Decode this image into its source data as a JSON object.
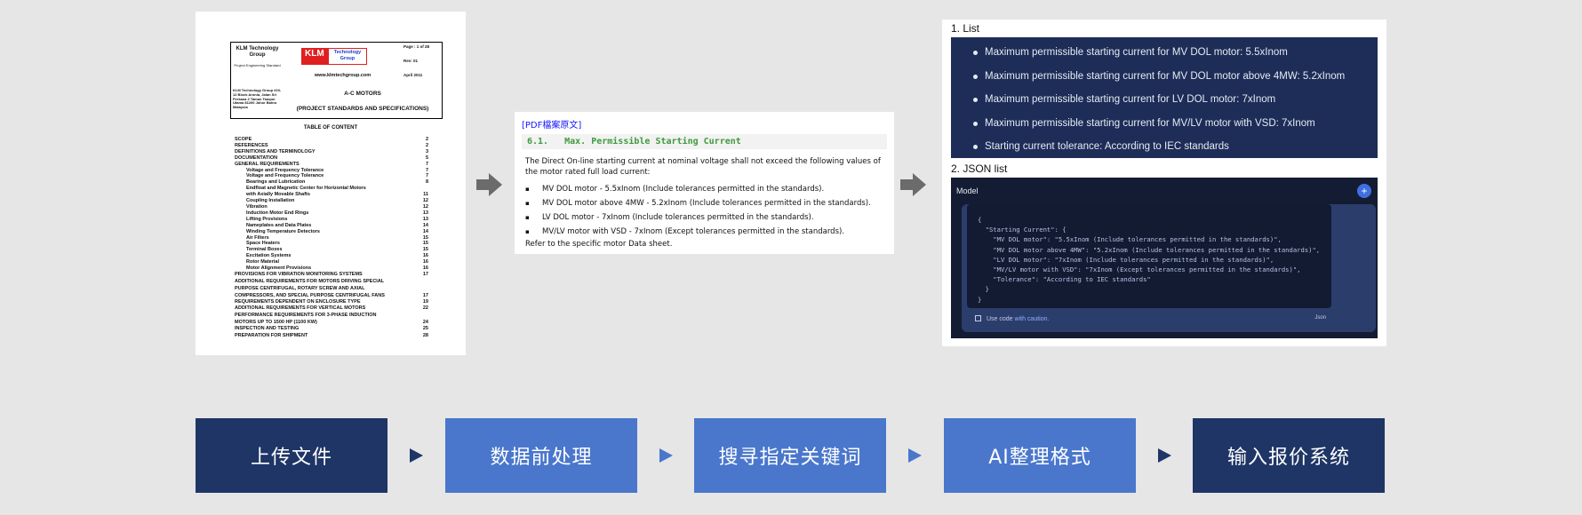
{
  "document": {
    "company": "KLM Technology Group",
    "company_sub": "Project Engineering Standard",
    "logo_left": "KLM",
    "logo_right_1": "Technology",
    "logo_right_2": "Group",
    "website": "www.klmtechgroup.com",
    "page": "Page : 1 of 28",
    "rev": "Rev: 01",
    "date": "April 2011",
    "address": "KLM Technology Group #03-12 Block Aronia, Jalan Sri Perkasa 2 Taman Tampoi Utama 81200 Johor Bahru Malaysia",
    "title": "A-C MOTORS",
    "subtitle": "(PROJECT STANDARDS AND SPECIFICATIONS)",
    "toc_heading": "TABLE OF CONTENT",
    "toc": [
      {
        "t": "SCOPE",
        "p": "2",
        "i": false
      },
      {
        "t": "REFERENCES",
        "p": "2",
        "i": false
      },
      {
        "t": "DEFINITIONS AND TERMINOLOGY",
        "p": "3",
        "i": false
      },
      {
        "t": "DOCUMENTATION",
        "p": "5",
        "i": false
      },
      {
        "t": "GENERAL REQUIREMENTS",
        "p": "7",
        "i": false
      },
      {
        "t": "Voltage and Frequency Tolerance",
        "p": "7",
        "i": true
      },
      {
        "t": "Voltage and Frequency Tolerance",
        "p": "7",
        "i": true
      },
      {
        "t": "Bearings and Lubrication",
        "p": "8",
        "i": true
      },
      {
        "t": "Endfloat and Magnetic Center for Horizontal Motors",
        "p": "",
        "i": true
      },
      {
        "t": "with Axially Movable Shafts",
        "p": "11",
        "i": true
      },
      {
        "t": "Coupling Installation",
        "p": "12",
        "i": true
      },
      {
        "t": "Vibration",
        "p": "12",
        "i": true
      },
      {
        "t": "Induction Motor End Rings",
        "p": "13",
        "i": true
      },
      {
        "t": "Lifting Provisions",
        "p": "13",
        "i": true
      },
      {
        "t": "Nameplates and Data Plates",
        "p": "14",
        "i": true
      },
      {
        "t": "Winding Temperature Detectors",
        "p": "14",
        "i": true
      },
      {
        "t": "Air Filters",
        "p": "15",
        "i": true
      },
      {
        "t": "Space Heaters",
        "p": "15",
        "i": true
      },
      {
        "t": "Terminal Boxes",
        "p": "15",
        "i": true
      },
      {
        "t": "Excitation Systems",
        "p": "16",
        "i": true
      },
      {
        "t": "Rotor Material",
        "p": "16",
        "i": true
      },
      {
        "t": "Motor Alignment Provisions",
        "p": "16",
        "i": true
      },
      {
        "t": "PROVISIONS FOR VIBRATION MONITORING SYSTEMS",
        "p": "17",
        "i": false
      },
      {
        "t": "ADDITIONAL REQUIREMENTS FOR MOTORS DRIVING SPECIAL",
        "p": "",
        "i": false,
        "g": true
      },
      {
        "t": "PURPOSE CENTRIFUGAL, ROTARY SCREW AND AXIAL",
        "p": "",
        "i": false,
        "g": true
      },
      {
        "t": "COMPRESSORS, AND SPECIAL PURPOSE CENTRIFUGAL FANS",
        "p": "17",
        "i": false,
        "g": true
      },
      {
        "t": "REQUIREMENTS DEPENDENT ON ENCLOSURE TYPE",
        "p": "19",
        "i": false
      },
      {
        "t": "ADDITIONAL REQUIREMENTS FOR VERTICAL MOTORS",
        "p": "22",
        "i": false,
        "g": true
      },
      {
        "t": "PERFORMANCE REQUIREMENTS FOR 3-PHASE INDUCTION",
        "p": "",
        "i": false,
        "g": true
      },
      {
        "t": "MOTORS UP TO 1500 HP (1100 KW)",
        "p": "24",
        "i": false,
        "g": true
      },
      {
        "t": "INSPECTION AND TESTING",
        "p": "25",
        "i": false
      },
      {
        "t": "PREPARATION FOR SHIPMENT",
        "p": "28",
        "i": false,
        "g": true
      }
    ]
  },
  "pdf": {
    "source_label": "[PDF檔案原文]",
    "section_no": "6.1.",
    "section_title": "Max. Permissible Starting Current",
    "intro": "The Direct On-line starting current at nominal voltage shall not exceed the following values of the motor rated full load current:",
    "bullet": "▪",
    "items": [
      "MV DOL motor - 5.5xInom (Include tolerances permitted in the standards).",
      "MV DOL motor above 4MW - 5.2xInom (Include tolerances permitted in the standards).",
      "LV DOL motor - 7xInom (Include tolerances permitted in the standards).",
      "MV/LV motor with VSD - 7xInom (Except tolerances permitted in the standards)."
    ],
    "footer": "Refer to the specific motor Data sheet."
  },
  "list_section": {
    "label": "1. List",
    "items": [
      "Maximum permissible starting current for MV DOL motor: 5.5xInom",
      "Maximum permissible starting current for MV DOL motor above 4MW: 5.2xInom",
      "Maximum permissible starting current for LV DOL motor: 7xInom",
      "Maximum permissible starting current for MV/LV motor with VSD: 7xInom",
      "Starting current tolerance: According to IEC standards"
    ]
  },
  "json_section": {
    "label": "2. JSON list",
    "model_label": "Model",
    "plus": "+",
    "code_lines": [
      "{",
      "  \"Starting Current\": {",
      "    \"MV DOL motor\": \"5.5xInom (Include tolerances permitted in the standards)\",",
      "    \"MV DOL motor above 4MW\": \"5.2xInom (Include tolerances permitted in the standards)\",",
      "    \"LV DOL motor\": \"7xInom (Include tolerances permitted in the standards)\",",
      "    \"MV/LV motor with VSD\": \"7xInom (Except tolerances permitted in the standards)\",",
      "    \"Tolerance\": \"According to IEC standards\"",
      "  }",
      "}"
    ],
    "footer_text": "Use code ",
    "footer_link": "with caution.",
    "footer_lang": "Json"
  },
  "flow": {
    "steps": [
      "上传文件",
      "数据前处理",
      "搜寻指定关键词",
      "AI整理格式",
      "输入报价系统"
    ]
  },
  "colors": {
    "background": "#e6e6e6",
    "step_dark": "#1f3566",
    "step_light": "#4a77cc",
    "list_bg": "#1d2d57",
    "json_bg": "#141c33",
    "section_green": "#3d9a3d",
    "link_blue": "#1515ff",
    "logo_red": "#e02020",
    "arrow_gray": "#6b6b6b"
  }
}
